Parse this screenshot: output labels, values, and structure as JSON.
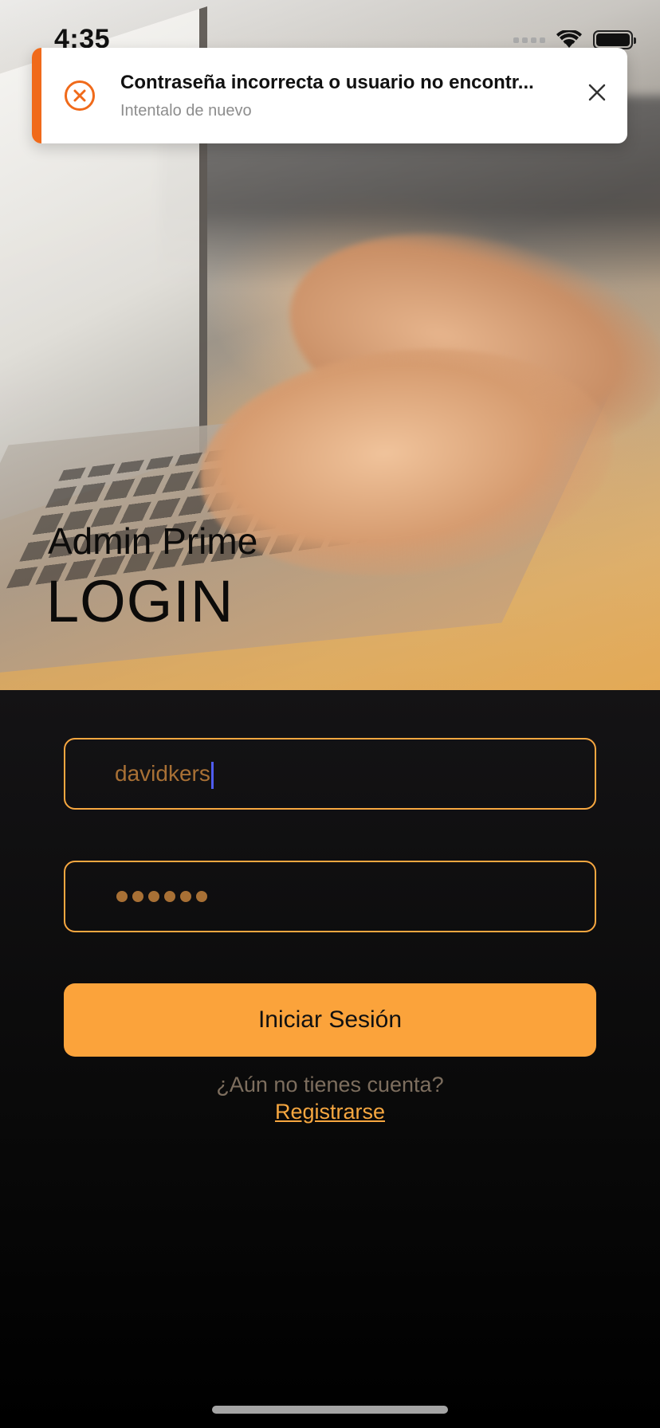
{
  "status_bar": {
    "time": "4:35"
  },
  "toast": {
    "title": "Contraseña incorrecta o usuario no encontr...",
    "message": "Intentalo de nuevo",
    "icon": "error-circle-x-icon",
    "close_icon": "close-icon",
    "accent_color": "#f06a1a"
  },
  "hero": {
    "subtitle": "Admin Prime",
    "title": "LOGIN"
  },
  "form": {
    "username_value": "davidkers",
    "password_mask_count": 6,
    "login_button": "Iniciar Sesión",
    "no_account_text": "¿Aún no tienes cuenta?",
    "register_link": "Registrarse"
  },
  "colors": {
    "accent": "#f7a740",
    "button_bg": "#fba33b",
    "field_text": "#a87035",
    "caret": "#4f5cf0"
  }
}
